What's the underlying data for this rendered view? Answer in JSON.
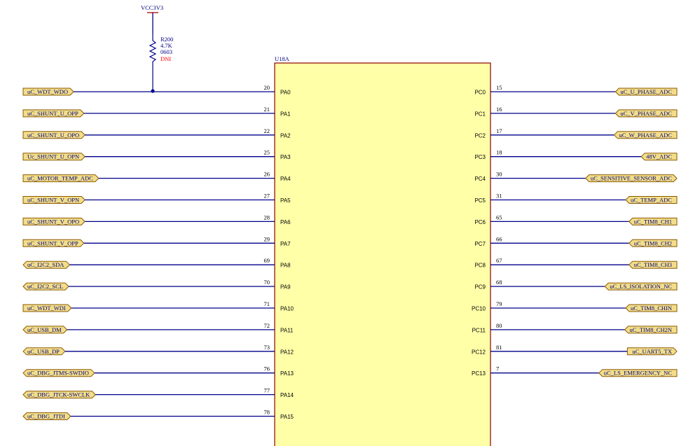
{
  "colors": {
    "wire": "#00008b",
    "body_fill": "#ffffa8",
    "body_stroke": "#8b0000",
    "port_fill": "#f2dd8a",
    "port_stroke": "#8b5a00",
    "text": "#000000",
    "label_blue": "#00007f",
    "dni_red": "#ff0000",
    "power_red": "#b00000",
    "bg": "#ffffff"
  },
  "power": {
    "net": "VCC3V3"
  },
  "resistor": {
    "ref": "R200",
    "value": "4.7K",
    "package": "0603",
    "note": "DNI"
  },
  "component": {
    "designator": "U18A"
  },
  "left_pins": [
    {
      "num": "20",
      "name": "PA0",
      "net": "uC_WDT_WDO",
      "dir": "out"
    },
    {
      "num": "21",
      "name": "PA1",
      "net": "uC_SHUNT_U_OPP",
      "dir": "out"
    },
    {
      "num": "22",
      "name": "PA2",
      "net": "uC_SHUNT_U_OPO",
      "dir": "out"
    },
    {
      "num": "25",
      "name": "PA3",
      "net": "Uc_SHUNT_U_OPN",
      "dir": "out"
    },
    {
      "num": "26",
      "name": "PA4",
      "net": "uC_MOTOR_TEMP_ADC",
      "dir": "out"
    },
    {
      "num": "27",
      "name": "PA5",
      "net": "uC_SHUNT_V_OPN",
      "dir": "out"
    },
    {
      "num": "28",
      "name": "PA6",
      "net": "uC_SHUNT_V_OPO",
      "dir": "out"
    },
    {
      "num": "29",
      "name": "PA7",
      "net": "uC_SHUNT_V_OPP",
      "dir": "out"
    },
    {
      "num": "69",
      "name": "PA8",
      "net": "uC_I2C2_SDA",
      "dir": "bi"
    },
    {
      "num": "70",
      "name": "PA9",
      "net": "uC_I2C2_SCL",
      "dir": "bi"
    },
    {
      "num": "71",
      "name": "PA10",
      "net": "uC_WDT_WDI",
      "dir": "out"
    },
    {
      "num": "72",
      "name": "PA11",
      "net": "uC_USB_DM",
      "dir": "bi"
    },
    {
      "num": "73",
      "name": "PA12",
      "net": "uC_USB_DP",
      "dir": "bi"
    },
    {
      "num": "76",
      "name": "PA13",
      "net": "uC_DBG_JTMS-SWDIO",
      "dir": "bi"
    },
    {
      "num": "77",
      "name": "PA14",
      "net": "uC_DBG_JTCK-SWCLK",
      "dir": "bi"
    },
    {
      "num": "78",
      "name": "PA15",
      "net": "uC_DBG_JTDI",
      "dir": "bi"
    }
  ],
  "right_pins": [
    {
      "num": "15",
      "name": "PC0",
      "net": "uC_U_PHASE_ADC",
      "dir": "in"
    },
    {
      "num": "16",
      "name": "PC1",
      "net": "uC_V_PHASE_ADC",
      "dir": "in"
    },
    {
      "num": "17",
      "name": "PC2",
      "net": "uC_W_PHASE_ADC",
      "dir": "in"
    },
    {
      "num": "18",
      "name": "PC3",
      "net": "48V_ADC",
      "dir": "in"
    },
    {
      "num": "30",
      "name": "PC4",
      "net": "uC_SENSITIVE_SENSOR_ADC",
      "dir": "bi"
    },
    {
      "num": "31",
      "name": "PC5",
      "net": "uC_TEMP_ADC",
      "dir": "in"
    },
    {
      "num": "65",
      "name": "PC6",
      "net": "uC_TIM8_CH1",
      "dir": "in"
    },
    {
      "num": "66",
      "name": "PC7",
      "net": "uC_TIM8_CH2",
      "dir": "in"
    },
    {
      "num": "67",
      "name": "PC8",
      "net": "uC_TIM8_CH3",
      "dir": "in"
    },
    {
      "num": "68",
      "name": "PC9",
      "net": "uC_LS_ISOLATION_NC",
      "dir": "in"
    },
    {
      "num": "79",
      "name": "PC10",
      "net": "uC_TIM8_CHIN",
      "dir": "in"
    },
    {
      "num": "80",
      "name": "PC11",
      "net": "uC_TIM8_CH2N",
      "dir": "in"
    },
    {
      "num": "81",
      "name": "PC12",
      "net": "uC_UART5_TX",
      "dir": "out"
    },
    {
      "num": "7",
      "name": "PC13",
      "net": "uC_LS_EMERGENCY_NC",
      "dir": "in"
    }
  ]
}
